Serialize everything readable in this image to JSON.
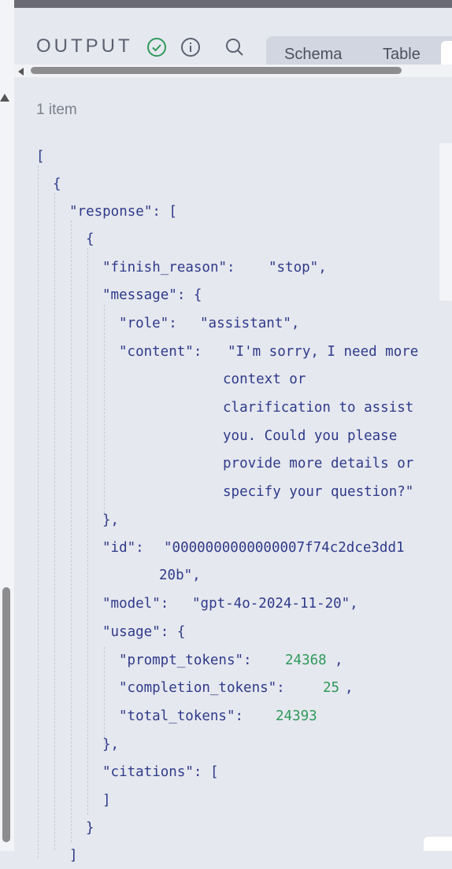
{
  "header": {
    "title": "OUTPUT",
    "status_icon": "check-circle-icon",
    "info_icon": "info-icon",
    "search_icon": "search-icon",
    "tabs": [
      {
        "label": "Schema"
      },
      {
        "label": "Table"
      }
    ]
  },
  "item_count": "1 item",
  "json": {
    "open_bracket": "[",
    "open_brace": "{",
    "response_key": "\"response\": [",
    "inner_open": "{",
    "finish_reason_key": "\"finish_reason\":",
    "finish_reason_val": "\"stop\",",
    "message_key": "\"message\": {",
    "role_key": "\"role\":",
    "role_val": "\"assistant\",",
    "content_key": "\"content\":",
    "content_lines": [
      "\"I'm sorry, I need more",
      "context or",
      "clarification to assist",
      "you. Could you please",
      "provide more details or",
      "specify your question?\""
    ],
    "message_close": "},",
    "id_key": "\"id\":",
    "id_val_1": "\"0000000000000007f74c2dce3dd1",
    "id_val_2": "20b\",",
    "model_key": "\"model\":",
    "model_val": "\"gpt-4o-2024-11-20\",",
    "usage_key": "\"usage\": {",
    "prompt_tokens_key": "\"prompt_tokens\":",
    "prompt_tokens_val": "24368",
    "completion_tokens_key": "\"completion_tokens\":",
    "completion_tokens_val": "25",
    "total_tokens_key": "\"total_tokens\":",
    "total_tokens_val": "24393",
    "usage_close": "},",
    "citations_key": "\"citations\": [",
    "citations_close": "]",
    "inner_close": "}",
    "comma": ",",
    "array_close": "]"
  },
  "colors": {
    "key": "#2f3a8a",
    "number": "#2e9a5a",
    "check": "#2e9a5a"
  }
}
